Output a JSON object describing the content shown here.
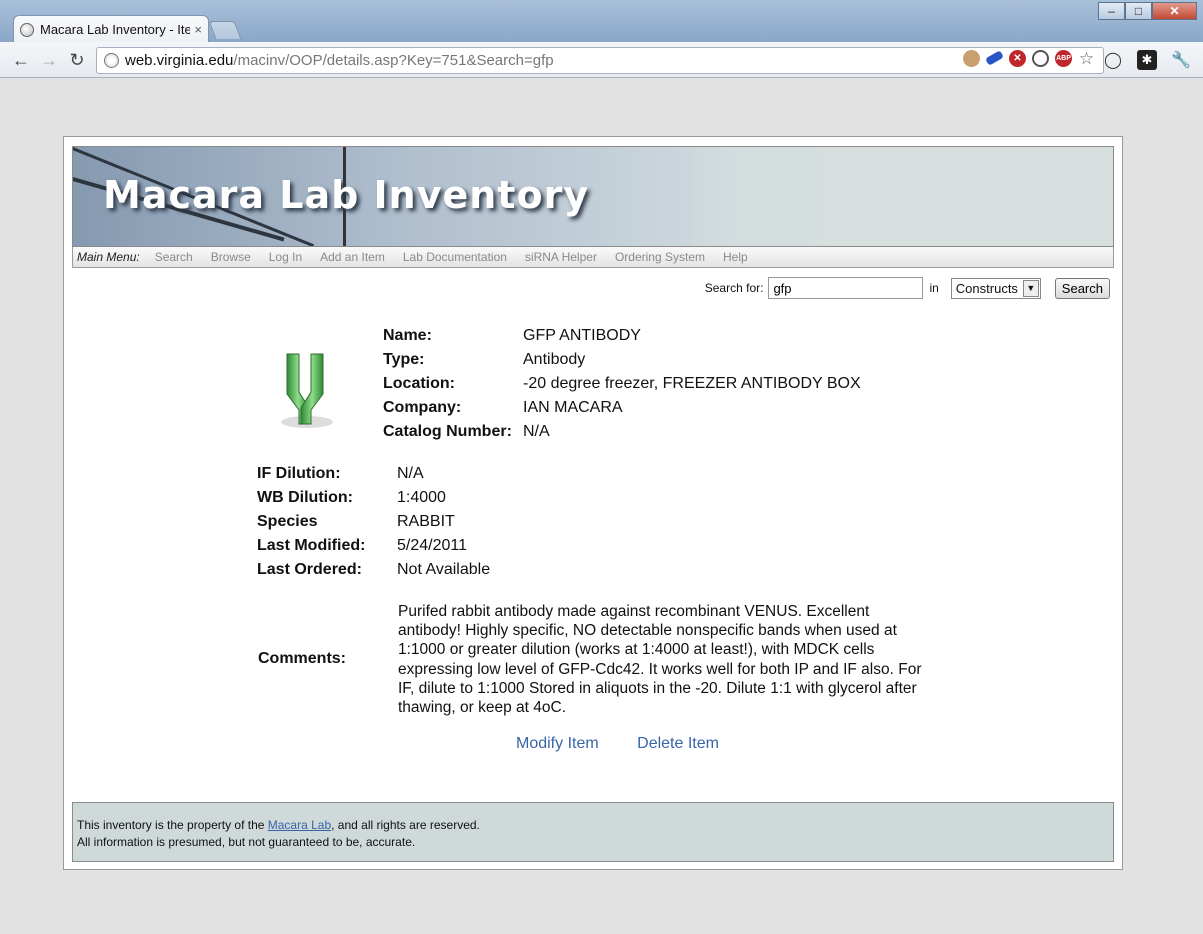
{
  "browser": {
    "tab_title": "Macara Lab Inventory - Iten",
    "tab_close": "×",
    "url_host": "web.virginia.edu",
    "url_path": "/macinv/OOP/details.asp?Key=751&Search=gfp",
    "extensions": [
      "cookie-icon",
      "usb-icon",
      "stop-icon",
      "disable-icon",
      "abp-icon",
      "star-icon"
    ],
    "abp_label": "ABP"
  },
  "site": {
    "title": "Macara Lab Inventory",
    "menu_label": "Main Menu:",
    "menu_items": [
      "Search",
      "Browse",
      "Log In",
      "Add an Item",
      "Lab Documentation",
      "siRNA Helper",
      "Ordering System",
      "Help"
    ]
  },
  "search": {
    "label": "Search for:",
    "value": "gfp",
    "in_label": "in",
    "category": "Constructs",
    "button": "Search"
  },
  "item": {
    "name_label": "Name:",
    "name": "GFP ANTIBODY",
    "type_label": "Type:",
    "type": "Antibody",
    "location_label": "Location:",
    "location": "-20 degree freezer, FREEZER ANTIBODY BOX",
    "company_label": "Company:",
    "company": "IAN MACARA",
    "catalog_label": "Catalog Number:",
    "catalog": "N/A",
    "if_label": "IF Dilution:",
    "if_dilution": "N/A",
    "wb_label": "WB Dilution:",
    "wb_dilution": "1:4000",
    "species_label": "Species",
    "species": "RABBIT",
    "modified_label": "Last Modified:",
    "modified": "5/24/2011",
    "ordered_label": "Last Ordered:",
    "ordered": "Not Available",
    "comments_label": "Comments:",
    "comments": "Purifed rabbit antibody made against recombinant VENUS. Excellent antibody! Highly specific, NO detectable nonspecific bands when used at 1:1000 or greater dilution (works at 1:4000 at least!), with MDCK cells expressing low level of GFP-Cdc42. It works well for both IP and IF also. For IF, dilute to 1:1000 Stored in aliquots in the -20. Dilute 1:1 with glycerol after thawing, or keep at 4oC."
  },
  "actions": {
    "modify": "Modify Item",
    "delete": "Delete Item"
  },
  "footer": {
    "line1_pre": "This inventory is the property of the ",
    "line1_link": "Macara Lab",
    "line1_post": ", and all rights are reserved.",
    "line2": "All information is presumed, but not guaranteed to be, accurate."
  },
  "colors": {
    "link": "#3a64a8",
    "banner_text": "#ffffff",
    "footer_bg": "#cfd9d9",
    "icon_green": "#4caf50"
  }
}
